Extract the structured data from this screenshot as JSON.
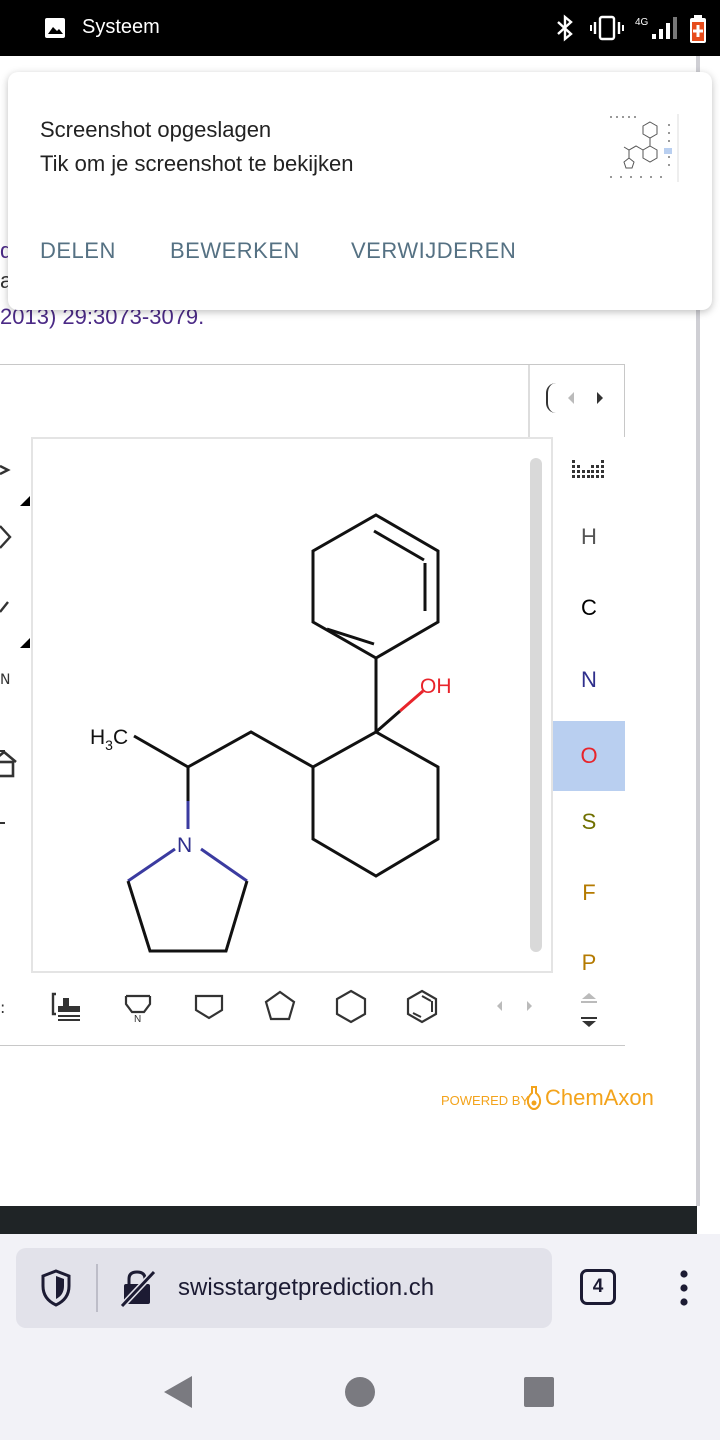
{
  "status_bar": {
    "app_title": "Systeem",
    "network": "4G",
    "icons": [
      "image-icon",
      "bluetooth-icon",
      "vibrate-icon",
      "signal-icon",
      "battery-icon"
    ]
  },
  "notification": {
    "title": "Screenshot opgeslagen",
    "text": "Tik om je screenshot te bekijken",
    "actions": [
      "DELEN",
      "BEWERKEN",
      "VERWIJDEREN"
    ]
  },
  "reference": {
    "line1": "d",
    "line2": "a",
    "line3": "2013) 29:3073-3079."
  },
  "editor": {
    "top_toolbar": [
      "home-icon",
      "open-folder-icon",
      "save-icon",
      "undo-icon",
      "redo-icon",
      "cut-icon",
      "copy-icon",
      "paste-icon"
    ],
    "elements": [
      {
        "symbol": "H",
        "color": "#555555"
      },
      {
        "symbol": "C",
        "color": "#000000"
      },
      {
        "symbol": "N",
        "color": "#2f2f8c"
      },
      {
        "symbol": "O",
        "color": "#e8242b",
        "selected": true
      },
      {
        "symbol": "S",
        "color": "#707000"
      },
      {
        "symbol": "F",
        "color": "#b47a00"
      },
      {
        "symbol": "P",
        "color": "#b47a00"
      }
    ],
    "shape_toolbar": [
      "template-icon",
      "pyrrolidine-template-icon",
      "square-ring-icon",
      "pentagon-ring-icon",
      "hexagon-ring-icon",
      "benzene-ring-icon"
    ],
    "molecule": {
      "labels": {
        "oh": "OH",
        "n": "N",
        "h3c": "H3C"
      }
    }
  },
  "powered_by": {
    "small": "POWERED BY",
    "brand": "ChemAxon"
  },
  "browser": {
    "url": "swisstargetprediction.ch",
    "tab_count": "4"
  },
  "colors": {
    "accent_notification": "#557183",
    "element_selected_bg": "#b9cff0",
    "chemaxon": "#f3a31b",
    "link_purple": "#4b2a86"
  }
}
